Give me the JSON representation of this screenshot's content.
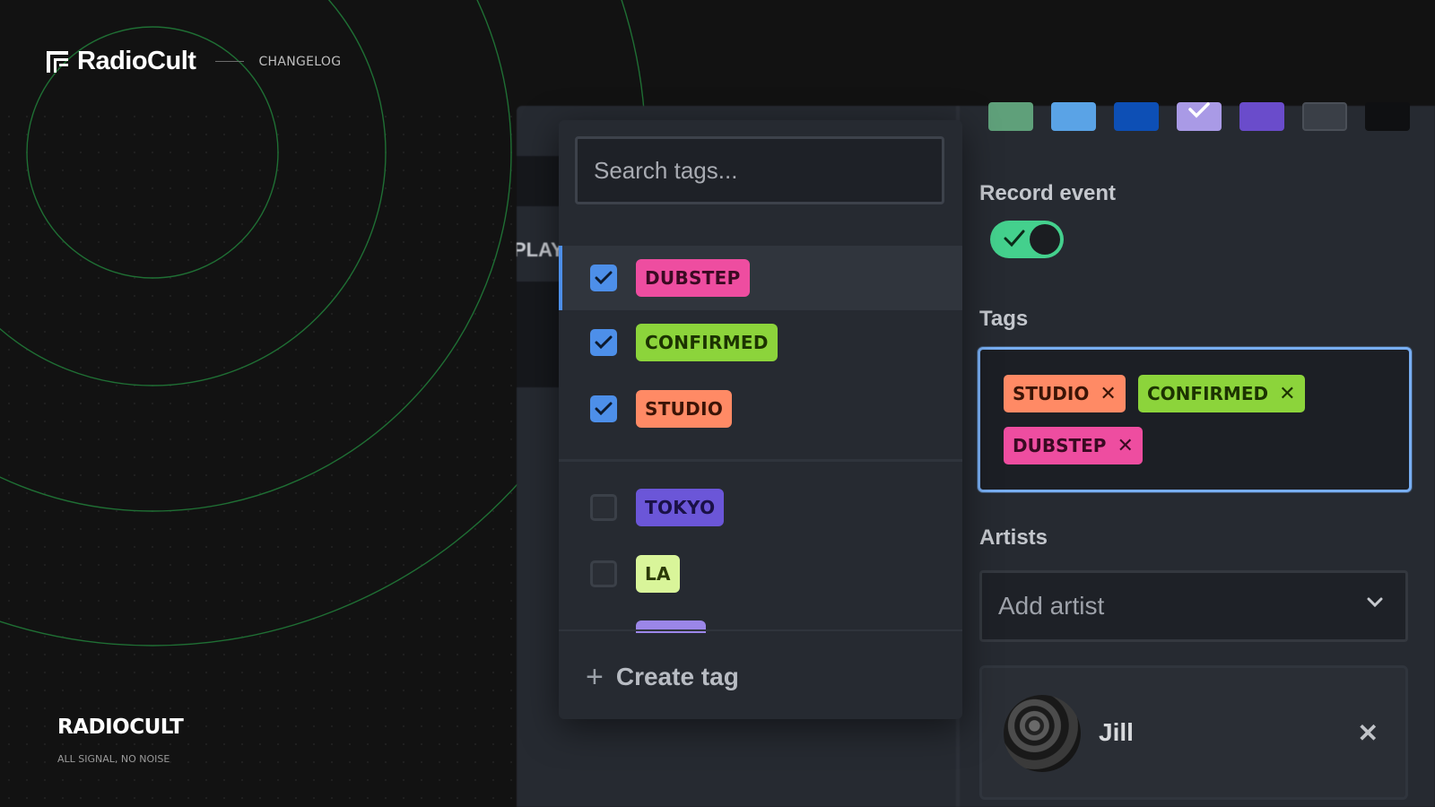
{
  "brand": {
    "name": "RadioCult",
    "nav_link": "CHANGELOG",
    "footer_name": "RADIOCULT",
    "footer_tagline": "ALL SIGNAL, NO NOISE"
  },
  "background_app": {
    "partial_text": "PLAY"
  },
  "tag_dropdown": {
    "search_placeholder": "Search tags...",
    "tags": [
      {
        "label": "DUBSTEP",
        "checked": true,
        "color": "#ee4da0",
        "text_color": "#3a0a22"
      },
      {
        "label": "CONFIRMED",
        "checked": true,
        "color": "#8cd43b",
        "text_color": "#1c3300"
      },
      {
        "label": "STUDIO",
        "checked": true,
        "color": "#ff8a65",
        "text_color": "#3b1406"
      },
      {
        "label": "TOKYO",
        "checked": false,
        "color": "#6b56d8",
        "text_color": "#1a1147"
      },
      {
        "label": "LA",
        "checked": false,
        "color": "#d9f59a",
        "text_color": "#2b3a06"
      }
    ],
    "create_label": "Create tag"
  },
  "form": {
    "color_swatches": [
      "#5fa07a",
      "#5aa3e6",
      "#0d4fb5",
      "#a99ae6",
      "#6a4ccb",
      "#3a3f47",
      "#0f1012"
    ],
    "selected_swatch_index": 3,
    "record_event_label": "Record event",
    "record_event_enabled": true,
    "tags_label": "Tags",
    "selected_tags": [
      {
        "label": "STUDIO",
        "color": "#ff8a65",
        "text_color": "#3b1406"
      },
      {
        "label": "CONFIRMED",
        "color": "#8cd43b",
        "text_color": "#1c3300"
      },
      {
        "label": "DUBSTEP",
        "color": "#ee4da0",
        "text_color": "#3a0a22"
      }
    ],
    "artists_label": "Artists",
    "artist_placeholder": "Add artist",
    "artist": {
      "name": "Jill"
    }
  }
}
